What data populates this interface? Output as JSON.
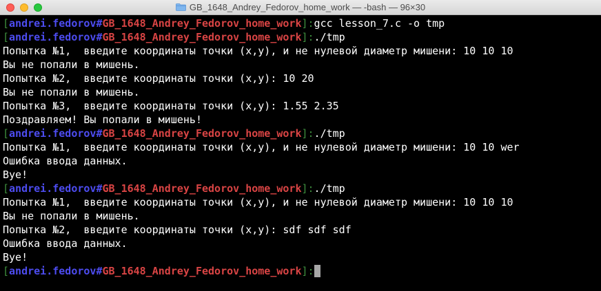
{
  "window": {
    "title": "GB_1648_Andrey_Fedorov_home_work — -bash — 96×30",
    "folder_icon": "folder-icon"
  },
  "prompt": {
    "user": "andrei.fedorov",
    "sep": "#",
    "host": "GB_1648_Andrey_Fedorov_home_work",
    "open_bracket": "[",
    "close_bracket": "]:"
  },
  "lines": [
    {
      "type": "prompt",
      "cmd": "gcc lesson_7.c -o tmp"
    },
    {
      "type": "prompt",
      "cmd": "./tmp"
    },
    {
      "type": "out",
      "text": "Попытка №1,  введите координаты точки (x,y), и не нулевой диаметр мишени: 10 10 10"
    },
    {
      "type": "out",
      "text": "Вы не попали в мишень."
    },
    {
      "type": "out",
      "text": "Попытка №2,  введите координаты точки (x,y): 10 20"
    },
    {
      "type": "out",
      "text": "Вы не попали в мишень."
    },
    {
      "type": "out",
      "text": "Попытка №3,  введите координаты точки (x,y): 1.55 2.35"
    },
    {
      "type": "out",
      "text": "Поздравляем! Вы попали в мишень!"
    },
    {
      "type": "prompt",
      "cmd": "./tmp"
    },
    {
      "type": "out",
      "text": "Попытка №1,  введите координаты точки (x,y), и не нулевой диаметр мишени: 10 10 wer"
    },
    {
      "type": "out",
      "text": "Ошибка ввода данных."
    },
    {
      "type": "out",
      "text": "Bye!"
    },
    {
      "type": "prompt",
      "cmd": "./tmp"
    },
    {
      "type": "out",
      "text": "Попытка №1,  введите координаты точки (x,y), и не нулевой диаметр мишени: 10 10 10"
    },
    {
      "type": "out",
      "text": "Вы не попали в мишень."
    },
    {
      "type": "out",
      "text": "Попытка №2,  введите координаты точки (x,y): sdf sdf sdf"
    },
    {
      "type": "out",
      "text": "Ошибка ввода данных."
    },
    {
      "type": "out",
      "text": "Bye!"
    },
    {
      "type": "prompt",
      "cmd": ""
    }
  ],
  "colors": {
    "background": "#000000",
    "text": "#ffffff",
    "bracket": "#3f8f3f",
    "user": "#4d4cf0",
    "host": "#d94444",
    "cursor": "#a6a6a6"
  }
}
